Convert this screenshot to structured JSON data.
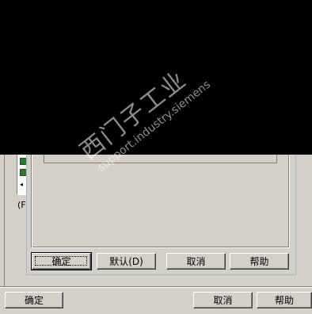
{
  "dialog": {
    "buttons": {
      "ok": "确定",
      "default": "默认(D)",
      "cancel": "取消",
      "help": "帮助"
    }
  },
  "window": {
    "buttons": {
      "ok": "确定",
      "cancel": "取消",
      "help": "帮助"
    },
    "left_label": "(F"
  },
  "watermark": {
    "text_cn": "西门子工业",
    "text_en": "support.industry.siemens"
  },
  "colors": {
    "face": "#d4d0c8",
    "dialog_border": "#9db9d6",
    "obscured_region": "#000000"
  }
}
